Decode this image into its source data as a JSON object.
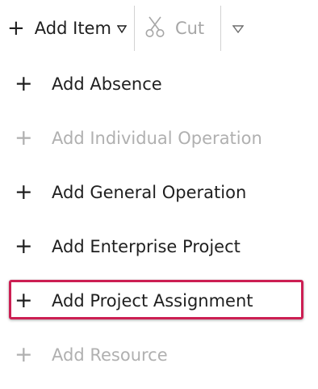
{
  "toolbar": {
    "add_item_label": "Add Item",
    "cut_label": "Cut",
    "add_item_icon": "plus-icon",
    "cut_icon": "scissors-icon",
    "more_icon": "caret-down-icon"
  },
  "menu": {
    "items": [
      {
        "label": "Add Absence",
        "disabled": false,
        "highlighted": false
      },
      {
        "label": "Add Individual Operation",
        "disabled": true,
        "highlighted": false
      },
      {
        "label": "Add General Operation",
        "disabled": false,
        "highlighted": false
      },
      {
        "label": "Add Enterprise Project",
        "disabled": false,
        "highlighted": false
      },
      {
        "label": "Add Project Assignment",
        "disabled": false,
        "highlighted": true
      },
      {
        "label": "Add Resource",
        "disabled": true,
        "highlighted": false
      }
    ]
  },
  "colors": {
    "highlight_border": "#cc1f53",
    "disabled_text": "#b0b0b0",
    "text": "#1f1f1f"
  }
}
